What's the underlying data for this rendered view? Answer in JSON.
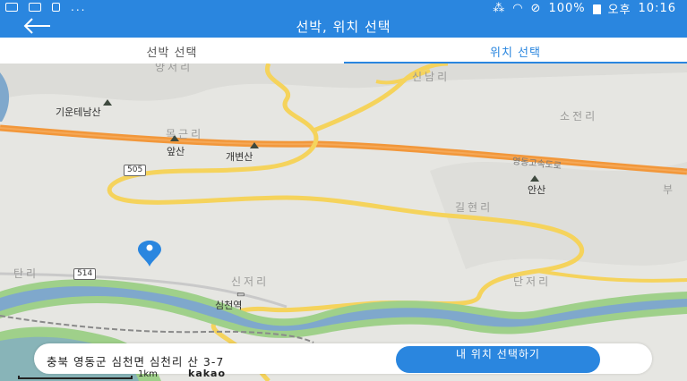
{
  "status_bar": {
    "battery_percent": "100%",
    "ampm": "오후",
    "time": "10:16",
    "left_dots": "..."
  },
  "app_bar": {
    "title": "선박, 위치 선택",
    "back_icon": "arrow-left-icon"
  },
  "tabs": [
    {
      "label": "선박 선택",
      "active": false
    },
    {
      "label": "위치 선택",
      "active": true
    }
  ],
  "map": {
    "labels": {
      "yangjeori": "양저리",
      "sinnamri": "신남리",
      "gimunhyeon": "기운테남산",
      "sojeonri": "소전리",
      "mokgeunri": "목근리",
      "apsan": "앞산",
      "gaebyeonsan": "개변산",
      "expressway": "영동고속도로",
      "ansan": "안산",
      "bu": "부",
      "gilhyeonri": "길현리",
      "tanri": "탄리",
      "sinjeori": "신저리",
      "danjeori": "단저리",
      "simcheonyeok": "심천역"
    },
    "route_shields": {
      "r505": "505",
      "r514": "514"
    },
    "colors": {
      "expressway": "#f2973a",
      "road": "#f5d35c",
      "river": "#7fa8cc",
      "riverbank": "#9fd08a"
    }
  },
  "pin": {
    "icon": "location-pin-icon",
    "color": "#2a86df"
  },
  "address": {
    "text": "충북 영동군 심천면 심천리 산 3-7",
    "button_label": "내 위치 선택하기"
  },
  "scale": {
    "label": "1km"
  },
  "attribution": {
    "logo": "kakao"
  }
}
